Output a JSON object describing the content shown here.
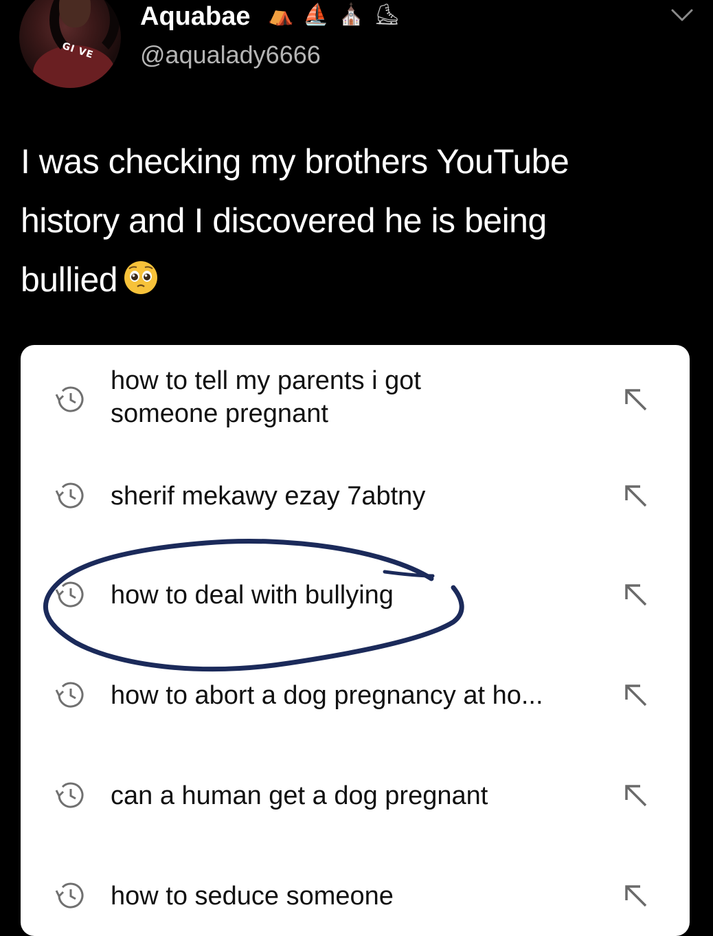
{
  "tweet": {
    "display_name": "Aquabae",
    "name_icons": [
      "⛺",
      "⛵",
      "⛪",
      "⛸"
    ],
    "handle": "@aqualady6666",
    "text_line1": "I was checking my brothers YouTube",
    "text_line2": "history and I discovered he is being",
    "text_line3": "bullied",
    "emoji": "pleading-face-icon",
    "avatar_logo": "GI\nVE"
  },
  "history": {
    "items": [
      {
        "line1": "how to tell my parents i got",
        "line2": "someone pregnant"
      },
      {
        "line1": "sherif mekawy ezay 7abtny",
        "line2": ""
      },
      {
        "line1": "how to deal with bullying",
        "line2": ""
      },
      {
        "line1": "how to abort a dog pregnancy at ho...",
        "line2": ""
      },
      {
        "line1": "can a human get a dog pregnant",
        "line2": ""
      },
      {
        "line1": "how to seduce someone",
        "line2": ""
      }
    ],
    "item_icon": "history-clock-icon",
    "action_icon": "insert-query-arrow-icon"
  },
  "colors": {
    "background": "#000000",
    "card": "#ffffff",
    "annotation_ink": "#1b2a5a"
  }
}
